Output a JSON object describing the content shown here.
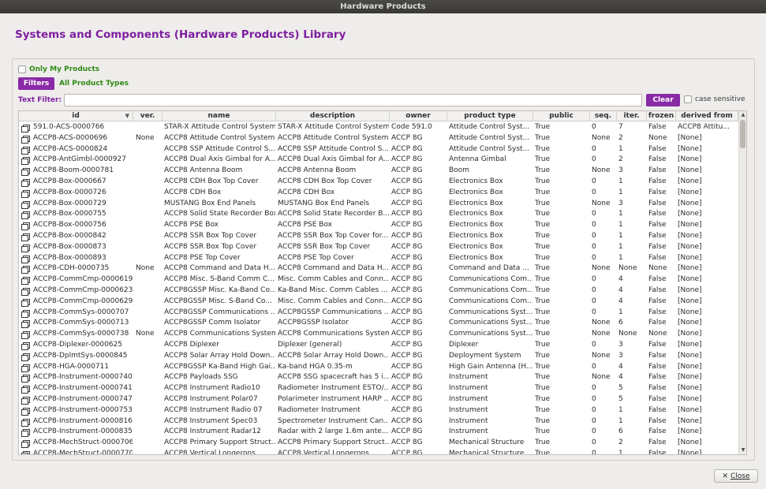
{
  "window": {
    "title": "Hardware Products"
  },
  "heading": "Systems and Components (Hardware Products) Library",
  "filters": {
    "only_my_products": "Only My Products",
    "filters_button": "Filters",
    "product_types": "All Product Types",
    "text_filter_label": "Text Filter:",
    "text_filter_value": "",
    "clear_button": "Clear",
    "case_sensitive": "case sensitive"
  },
  "table": {
    "columns": [
      "id",
      "ver.",
      "name",
      "description",
      "owner",
      "product type",
      "public",
      "seq.",
      "iter.",
      "frozen",
      "derived from"
    ],
    "rows": [
      [
        "591.0-ACS-0000766",
        "",
        "STAR-X Attitude Control System",
        "STAR-X Attitude Control System",
        "Code 591.0",
        "Attitude Control Syst...",
        "True",
        "0",
        "7",
        "False",
        "ACCP8 Attitu..."
      ],
      [
        "ACCP8-ACS-0000696",
        "None",
        "ACCP8 Attitude Control System",
        "ACCP8 Attitude Control System",
        "ACCP 8G",
        "Attitude Control Syst...",
        "True",
        "None",
        "2",
        "None",
        "[None]"
      ],
      [
        "ACCP8-ACS-0000824",
        "",
        "ACCP8 SSP Attitude Control S...",
        "ACCP8 SSP Attitude Control S...",
        "ACCP 8G",
        "Attitude Control Syst...",
        "True",
        "0",
        "1",
        "False",
        "[None]"
      ],
      [
        "ACCP8-AntGimbl-0000927",
        "",
        "ACCP8 Dual Axis Gimbal for A...",
        "ACCP8 Dual Axis Gimbal for A...",
        "ACCP 8G",
        "Antenna Gimbal",
        "True",
        "0",
        "2",
        "False",
        "[None]"
      ],
      [
        "ACCP8-Boom-0000781",
        "",
        "ACCP8 Antenna Boom",
        "ACCP8 Antenna Boom",
        "ACCP 8G",
        "Boom",
        "True",
        "None",
        "3",
        "False",
        "[None]"
      ],
      [
        "ACCP8-Box-0000667",
        "",
        "ACCP8 CDH Box Top Cover",
        "ACCP8 CDH Box Top Cover",
        "ACCP 8G",
        "Electronics Box",
        "True",
        "0",
        "1",
        "False",
        "[None]"
      ],
      [
        "ACCP8-Box-0000726",
        "",
        "ACCP8 CDH Box",
        "ACCP8 CDH Box",
        "ACCP 8G",
        "Electronics Box",
        "True",
        "0",
        "1",
        "False",
        "[None]"
      ],
      [
        "ACCP8-Box-0000729",
        "",
        "MUSTANG Box End Panels",
        "MUSTANG Box End Panels",
        "ACCP 8G",
        "Electronics Box",
        "True",
        "None",
        "3",
        "False",
        "[None]"
      ],
      [
        "ACCP8-Box-0000755",
        "",
        "ACCP8 Solid State Recorder Box",
        "ACCP8 Solid State Recorder B...",
        "ACCP 8G",
        "Electronics Box",
        "True",
        "0",
        "1",
        "False",
        "[None]"
      ],
      [
        "ACCP8-Box-0000756",
        "",
        "ACCP8 PSE Box",
        "ACCP8 PSE Box",
        "ACCP 8G",
        "Electronics Box",
        "True",
        "0",
        "1",
        "False",
        "[None]"
      ],
      [
        "ACCP8-Box-0000842",
        "",
        "ACCP8 SSR Box Top Cover",
        "ACCP8 SSR Box Top Cover for...",
        "ACCP 8G",
        "Electronics Box",
        "True",
        "0",
        "1",
        "False",
        "[None]"
      ],
      [
        "ACCP8-Box-0000873",
        "",
        "ACCP8 SSR Box Top Cover",
        "ACCP8 SSR Box Top Cover",
        "ACCP 8G",
        "Electronics Box",
        "True",
        "0",
        "1",
        "False",
        "[None]"
      ],
      [
        "ACCP8-Box-0000893",
        "",
        "ACCP8 PSE Top Cover",
        "ACCP8 PSE Top Cover",
        "ACCP 8G",
        "Electronics Box",
        "True",
        "0",
        "1",
        "False",
        "[None]"
      ],
      [
        "ACCP8-CDH-0000735",
        "None",
        "ACCP8 Command and Data H...",
        "ACCP8 Command and Data H...",
        "ACCP 8G",
        "Command and Data ...",
        "True",
        "None",
        "None",
        "None",
        "[None]"
      ],
      [
        "ACCP8-CommCmp-0000619",
        "",
        "ACCP8 Misc. S-Band Comm C...",
        "Misc. Comm Cables and Conn...",
        "ACCP 8G",
        "Communications Com...",
        "True",
        "0",
        "4",
        "False",
        "[None]"
      ],
      [
        "ACCP8-CommCmp-0000623",
        "",
        "ACCP8GSSP Misc. Ka-Band Co...",
        "Ka-Band Misc. Comm Cables ...",
        "ACCP 8G",
        "Communications Com...",
        "True",
        "0",
        "4",
        "False",
        "[None]"
      ],
      [
        "ACCP8-CommCmp-0000629",
        "",
        "ACCP8GSSP Misc. S-Band Co...",
        "Misc. Comm Cables and Conn...",
        "ACCP 8G",
        "Communications Com...",
        "True",
        "0",
        "4",
        "False",
        "[None]"
      ],
      [
        "ACCP8-CommSys-0000707",
        "",
        "ACCP8GSSP Communications ...",
        "ACCP8GSSP Communications ...",
        "ACCP 8G",
        "Communications Syst...",
        "True",
        "0",
        "1",
        "False",
        "[None]"
      ],
      [
        "ACCP8-CommSys-0000713",
        "",
        "ACCP8GSSP Comm Isolator",
        "ACCP8GSSP Isolator",
        "ACCP 8G",
        "Communications Syst...",
        "True",
        "None",
        "6",
        "False",
        "[None]"
      ],
      [
        "ACCP8-CommSys-0000738",
        "None",
        "ACCP8 Communications System",
        "ACCP8 Communications System",
        "ACCP 8G",
        "Communications Syst...",
        "True",
        "None",
        "None",
        "None",
        "[None]"
      ],
      [
        "ACCP8-Diplexer-0000625",
        "",
        "ACCP8 Diplexer",
        "Diplexer (general)",
        "ACCP 8G",
        "Diplexer",
        "True",
        "0",
        "3",
        "False",
        "[None]"
      ],
      [
        "ACCP8-DplmtSys-0000845",
        "",
        "ACCP8 Solar Array Hold Down...",
        "ACCP8 Solar Array Hold Down...",
        "ACCP 8G",
        "Deployment System",
        "True",
        "None",
        "3",
        "False",
        "[None]"
      ],
      [
        "ACCP8-HGA-0000711",
        "",
        "ACCP8GSSP Ka-Band High Gai...",
        "Ka-band HGA 0.35-m",
        "ACCP 8G",
        "High Gain Antenna (H...",
        "True",
        "0",
        "4",
        "False",
        "[None]"
      ],
      [
        "ACCP8-Instrument-0000740",
        "",
        "ACCP8 Payloads SSG",
        "ACCP8 SSG spacecraft has 5 i...",
        "ACCP 8G",
        "Instrument",
        "True",
        "None",
        "4",
        "False",
        "[None]"
      ],
      [
        "ACCP8-Instrument-0000741",
        "",
        "ACCP8 Instrument Radio10",
        "Radiometer Instrument ESTO/...",
        "ACCP 8G",
        "Instrument",
        "True",
        "0",
        "5",
        "False",
        "[None]"
      ],
      [
        "ACCP8-Instrument-0000747",
        "",
        "ACCP8 Instrument Polar07",
        "Polarimeter Instrument HARP ...",
        "ACCP 8G",
        "Instrument",
        "True",
        "0",
        "5",
        "False",
        "[None]"
      ],
      [
        "ACCP8-Instrument-0000753",
        "",
        "ACCP8 Instrument Radio 07",
        "Radiometer Instrument",
        "ACCP 8G",
        "Instrument",
        "True",
        "0",
        "1",
        "False",
        "[None]"
      ],
      [
        "ACCP8-Instrument-0000816",
        "",
        "ACCP8 Instrument Spec03",
        "Spectrometer Instrument Can...",
        "ACCP 8G",
        "Instrument",
        "True",
        "0",
        "1",
        "False",
        "[None]"
      ],
      [
        "ACCP8-Instrument-0000835",
        "",
        "ACCP8 Instrument Radar12",
        "Radar with 2 large 1.6m ante...",
        "ACCP 8G",
        "Instrument",
        "True",
        "0",
        "6",
        "False",
        "[None]"
      ],
      [
        "ACCP8-MechStruct-0000706",
        "",
        "ACCP8 Primary Support Struct...",
        "ACCP8 Primary Support Struct...",
        "ACCP 8G",
        "Mechanical Structure",
        "True",
        "0",
        "2",
        "False",
        "[None]"
      ],
      [
        "ACCP8-MechStruct-0000770",
        "",
        "ACCP8 Vertical Longerons",
        "ACCP8 Vertical Longerons",
        "ACCP 8G",
        "Mechanical Structure",
        "True",
        "0",
        "1",
        "False",
        "[None]"
      ]
    ]
  },
  "close_button": {
    "icon": "close-x-icon",
    "label": "Close"
  }
}
